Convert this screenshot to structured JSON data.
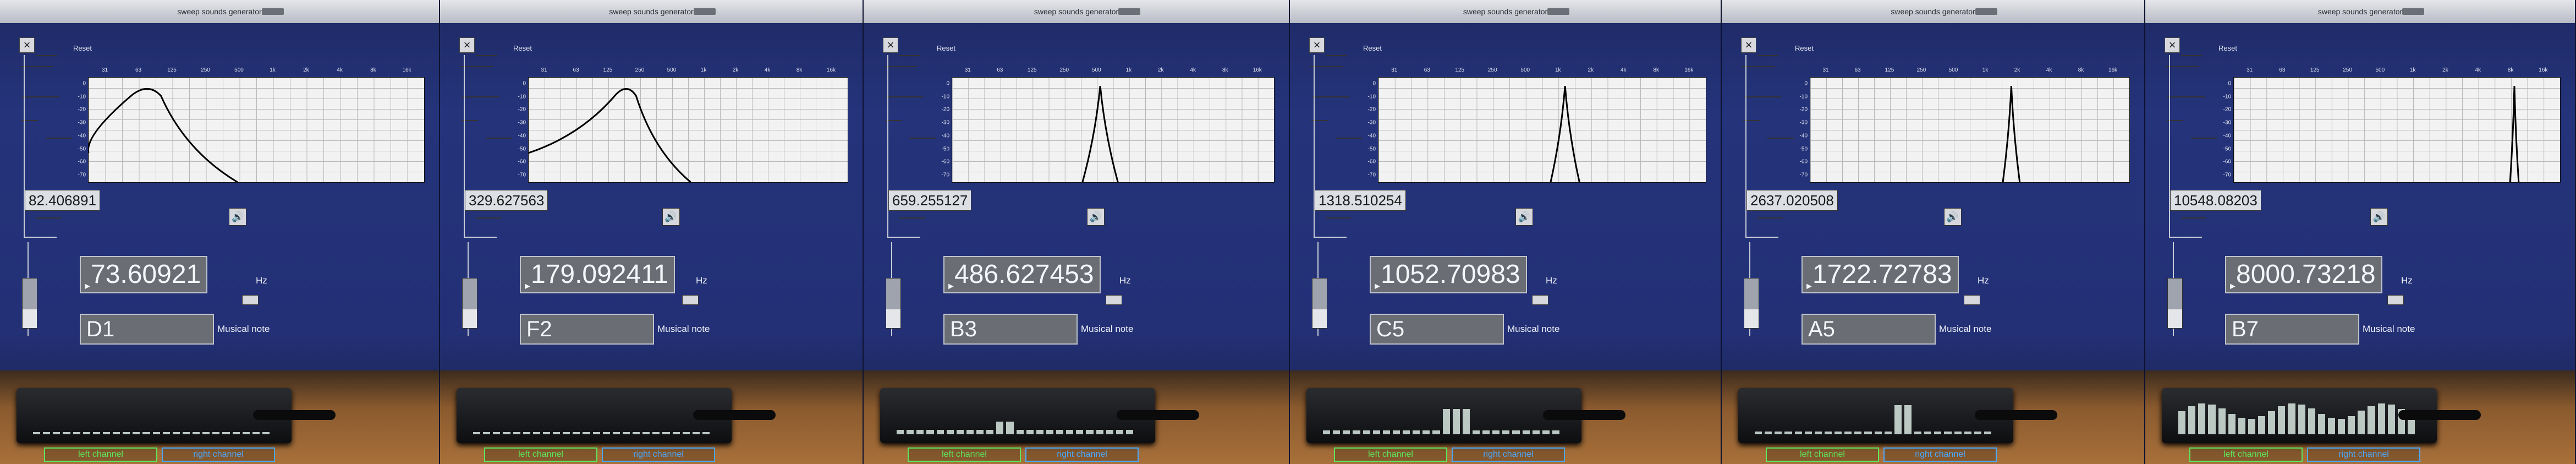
{
  "app": {
    "window_title": "sweep sounds generator"
  },
  "controls": {
    "close_glyph": "×",
    "reset_label": "Reset",
    "speaker_glyph": "🔊",
    "hz_unit": "Hz",
    "note_label": "Musical note",
    "left_channel_label": "left channel",
    "right_channel_label": "right channel"
  },
  "graph": {
    "freq_ticks": [
      "31",
      "63",
      "125",
      "250",
      "500",
      "1k",
      "2k",
      "4k",
      "8k",
      "16k"
    ],
    "db_ticks": [
      "0",
      "-10",
      "-20",
      "-30",
      "-40",
      "-50",
      "-60",
      "-70"
    ]
  },
  "panels": [
    {
      "target_frequency": "82.406891",
      "measured_frequency": "73.60921",
      "note": "D1",
      "peak_position": 0.18,
      "peak_width": 0.12,
      "spectrum_level": 0.05,
      "spectrum_peak": 0.0
    },
    {
      "target_frequency": "329.627563",
      "measured_frequency": "179.092411",
      "note": "F2",
      "peak_position": 0.31,
      "peak_width": 0.09,
      "spectrum_level": 0.05,
      "spectrum_peak": 0.0
    },
    {
      "target_frequency": "659.255127",
      "measured_frequency": "486.627453",
      "note": "B3",
      "peak_position": 0.46,
      "peak_width": 0.025,
      "spectrum_level": 0.12,
      "spectrum_peak": 0.35
    },
    {
      "target_frequency": "1318.510254",
      "measured_frequency": "1052.70983",
      "note": "C5",
      "peak_position": 0.57,
      "peak_width": 0.02,
      "spectrum_level": 0.1,
      "spectrum_peak": 0.7
    },
    {
      "target_frequency": "2637.020508",
      "measured_frequency": "1722.72783",
      "note": "A5",
      "peak_position": 0.63,
      "peak_width": 0.012,
      "spectrum_level": 0.08,
      "spectrum_peak": 0.8
    },
    {
      "target_frequency": "10548.08203",
      "measured_frequency": "8000.73218",
      "note": "B7",
      "peak_position": 0.86,
      "peak_width": 0.006,
      "spectrum_level": 0.85,
      "spectrum_peak": 0.9
    }
  ]
}
